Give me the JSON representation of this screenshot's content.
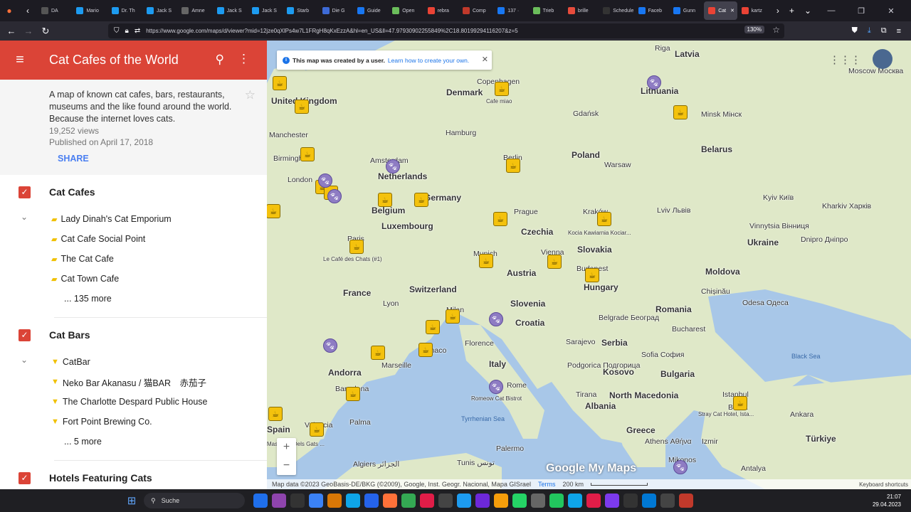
{
  "browser": {
    "tabs": [
      {
        "label": "DA",
        "color": "#555"
      },
      {
        "label": "Mario",
        "color": "#1d9bf0"
      },
      {
        "label": "Dr. Th",
        "color": "#1d9bf0"
      },
      {
        "label": "Jack S",
        "color": "#1d9bf0"
      },
      {
        "label": "Amne",
        "color": "#666"
      },
      {
        "label": "Jack S",
        "color": "#1d9bf0"
      },
      {
        "label": "Jack S",
        "color": "#1d9bf0"
      },
      {
        "label": "Starb",
        "color": "#1d9bf0"
      },
      {
        "label": "Die G",
        "color": "#3d6ad6"
      },
      {
        "label": "Guide",
        "color": "#1877f2"
      },
      {
        "label": "Open",
        "color": "#6bbd5b"
      },
      {
        "label": "rebra",
        "color": "#ea4335"
      },
      {
        "label": "Comp",
        "color": "#c0392b"
      },
      {
        "label": "137 ·",
        "color": "#1877f2"
      },
      {
        "label": "Trieb",
        "color": "#6bbd5b"
      },
      {
        "label": "brille",
        "color": "#e74c3c"
      },
      {
        "label": "Schedule",
        "color": "#333"
      },
      {
        "label": "Faceb",
        "color": "#1877f2"
      },
      {
        "label": "Gunn",
        "color": "#1877f2"
      },
      {
        "label": "Cat",
        "color": "#ea4335",
        "active": true
      },
      {
        "label": "kartz",
        "color": "#ea4335"
      }
    ],
    "url": "https://www.google.com/maps/d/viewer?mid=12jze0qXlPs4w7L1FRgH8qKxEzzA&hl=en_US&ll=47.97930902255849%2C18.80199294116207&z=5",
    "zoom": "130%"
  },
  "sidebar": {
    "title": "Cat Cafes of the World",
    "description": "A map of known cat cafes, bars, restaurants, museums and the like found around the world. Because the internet loves cats.",
    "views": "19,252 views",
    "published": "Published on April 17, 2018",
    "share_label": "SHARE",
    "layers": [
      {
        "title": "Cat Cafes",
        "items": [
          "Lady Dinah's Cat Emporium",
          "Cat Cafe Social Point",
          "The Cat Cafe",
          "Cat Town Cafe"
        ],
        "more": "... 135 more"
      },
      {
        "title": "Cat Bars",
        "items": [
          "CatBar",
          "Neko Bar Akanasu / 猫BAR　赤茄子",
          "The Charlotte Despard Public House",
          "Fort Point Brewing Co."
        ],
        "more": "... 5 more"
      },
      {
        "title": "Hotels Featuring Cats",
        "items": [],
        "more": ""
      }
    ]
  },
  "map": {
    "banner_text": "This map was created by a user.",
    "banner_link": "Learn how to create your own.",
    "brand": "Google My Maps",
    "attribution": "Map data ©2023 GeoBasis-DE/BKG (©2009), Google, Inst. Geogr. Nacional, Mapa GISrael",
    "terms": "Terms",
    "scale": "200 km",
    "keyboard": "Keyboard shortcuts",
    "countries": [
      "Latvia",
      "Lithuania",
      "Denmark",
      "United Kingdom",
      "Belarus",
      "Poland",
      "Netherlands",
      "Germany",
      "Belgium",
      "Luxembourg",
      "Czechia",
      "Slovakia",
      "Ukraine",
      "France",
      "Switzerland",
      "Austria",
      "Hungary",
      "Moldova",
      "Slovenia",
      "Croatia",
      "Romania",
      "Serbia",
      "Italy",
      "Bulgaria",
      "Kosovo",
      "North Macedonia",
      "Albania",
      "Andorra",
      "Spain",
      "Greece",
      "Türkiye"
    ],
    "cities": [
      "Riga",
      "Moscow Москва",
      "Copenhagen",
      "Gdańsk",
      "Minsk Мінск",
      "Manchester",
      "Hamburg",
      "Birmingham",
      "Amsterdam",
      "Berlin",
      "Warsaw",
      "London",
      "Kraków",
      "Lviv Львів",
      "Kharkiv Харків",
      "Kyiv Київ",
      "Prague",
      "Vinnytsia Вінниця",
      "Paris",
      "Munich",
      "Vienna",
      "Dnipro Дніпро",
      "Budapest",
      "Chișinău",
      "Lyon",
      "Milan",
      "Odesa Одеса",
      "Belgrade Београд",
      "Bucharest",
      "Florence",
      "Marseille",
      "Monaco",
      "Sarajevo",
      "Barcelona",
      "Rome",
      "Podgorica Подгорица",
      "Sofia София",
      "Tirana",
      "Istanbul",
      "Bursa",
      "Ankara",
      "Valencia",
      "Palma",
      "Athens Αθήνα",
      "Izmir",
      "Algiers الجزائر",
      "Tunis تونس",
      "Palermo",
      "Antalya",
      "Mikonos"
    ],
    "seas": [
      "Black Sea",
      "Tyrrhenian Sea"
    ],
    "poi": [
      "Cafe miao",
      "Le Café des Chats (#1)",
      "Kocia Kawiarnia Kociar...",
      "Romeow Cat Bistrot",
      "Stray Cat Hotel, Ista...",
      "Massagte Dels Gats ..."
    ]
  },
  "taskbar": {
    "search_label": "Suche",
    "time": "21:07",
    "date": "29.04.2023"
  },
  "colors": {
    "brand_red": "#db4437",
    "marker_yellow": "#f4c20d",
    "marker_purple": "#8e7cc3",
    "link_blue": "#4a7ff1"
  }
}
